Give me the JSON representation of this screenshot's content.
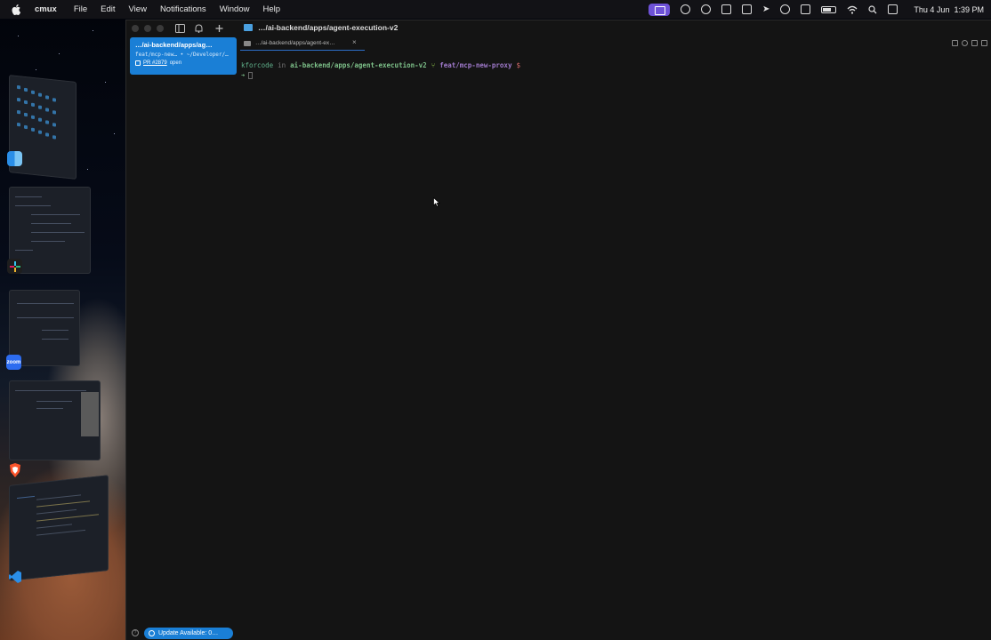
{
  "menubar": {
    "app_name": "cmux",
    "menus": [
      "File",
      "Edit",
      "View",
      "Notifications",
      "Window",
      "Help"
    ],
    "date": "Thu 4 Jun",
    "time": "1:39 PM",
    "status_icons": [
      "screen-share-icon",
      "record-icon",
      "menu-app-icon",
      "layers-icon",
      "bracket-icon",
      "play-arrow-icon",
      "play-circle-icon",
      "display-icon",
      "battery-icon",
      "wifi-icon",
      "search-icon",
      "control-center-icon"
    ]
  },
  "window": {
    "title": "…/ai-backend/apps/agent-execution-v2"
  },
  "sidebar": {
    "workspace": {
      "title": "…/ai-backend/apps/ag…",
      "subtitle": "feat/mcp-new… • ~/Developer/…",
      "pr_label": "PR #2879",
      "pr_status": "open"
    }
  },
  "tabs": [
    {
      "label": "…/ai-backend/apps/agent-ex…",
      "close": "×"
    }
  ],
  "terminal": {
    "user": "kforcode",
    "in": "in",
    "path": "ai-backend/apps/agent-execution-v2",
    "branch_icon": "⑂",
    "branch": "feat/mcp-new-proxy",
    "dollar": "$",
    "arrow": "➜"
  },
  "statusbar": {
    "help": "?",
    "update_label": "Update Available: 0…"
  },
  "dock": {
    "apps": [
      "finder-icon",
      "slack-icon",
      "zoom-icon",
      "brave-icon",
      "vscode-icon"
    ],
    "zoom_label": "zoom"
  }
}
